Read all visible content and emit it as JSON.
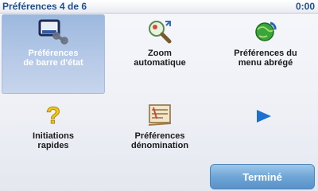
{
  "header": {
    "title": "Préférences 4 de 6",
    "clock": "0:00"
  },
  "menu": {
    "items": [
      {
        "label": "Préférences\nde barre d'état",
        "icon": "status-bar-settings-icon"
      },
      {
        "label": "Zoom\nautomatique",
        "icon": "magnifier-zoom-icon"
      },
      {
        "label": "Préférences du\nmenu abrégé",
        "icon": "quick-menu-globe-icon"
      },
      {
        "label": "Initiations\nrapides",
        "icon": "question-mark-icon"
      },
      {
        "label": "Préférences\ndénomination",
        "icon": "street-name-sign-icon"
      }
    ],
    "next_icon": "right-arrow-icon"
  },
  "footer": {
    "done_label": "Terminé"
  },
  "colors": {
    "accent": "#1f4f8f",
    "selected_tile": "#a8bfe2",
    "button": "#6fa6d6",
    "arrow": "#1e6fd0"
  }
}
